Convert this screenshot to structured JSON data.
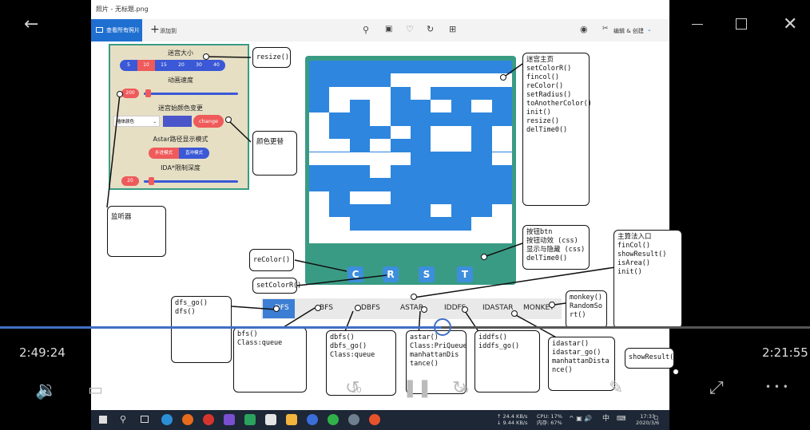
{
  "player": {
    "back_icon": "back-arrow-icon",
    "minimize_icon": "minimize-icon",
    "maximize_icon": "maximize-icon",
    "close_icon": "close-icon",
    "elapsed": "2:49:24",
    "remaining": "2:21:55",
    "progress_fraction": 0.545,
    "volume_icon": "volume-icon",
    "subtitle_icon": "subtitles-icon",
    "skip_back_label": "10",
    "skip_forward_label": "30",
    "more_label": "• • •"
  },
  "photos": {
    "window_title": "照片 - 无标题.png",
    "see_all_label": "查看所有照片",
    "add_to_label": "添加到",
    "edit_create_label": "编辑 & 创建"
  },
  "panel": {
    "maze_size_label": "迷宫大小",
    "sizes": [
      "5",
      "10",
      "15",
      "20",
      "30",
      "40"
    ],
    "selected_size": "10",
    "anim_speed_label": "动画速度",
    "anim_speed_value": "200",
    "color_change_label": "迷宫始颜色变更",
    "color_select": "墙体颜色",
    "change_label": "change",
    "astar_mode_label": "Astar路径显示模式",
    "astar_modes": [
      "步进模式",
      "直冲模式"
    ],
    "ida_depth_label": "IDA*限制深度",
    "ida_depth_value": "20"
  },
  "notes": {
    "resize": "resize()",
    "color_change": "颜色更替",
    "listener": "监听器",
    "maze_home": "迷宫主页\nsetColorR()\nfincol()\nreColor()\nsetRadius()\ntoAnotherColor()\n init()\n resize()\n delTime0()",
    "buttons": "按钮btn\n按钮动效 (css)\n显示与隐藏 (css)\ndelTime0()",
    "main_entry": "主算法入口\nfinCol()\nshowResult()\nisArea()\ninit()",
    "recolor": "reColor()",
    "setcolor": "setColorR()",
    "dfs_go": "dfs_go()\ndfs()",
    "bfs": "bfs()\nClass:queue",
    "dbfs": "dbfs()\ndbfs_go()\nClass:queue",
    "astar": "astar()\nClass:PriQueue\nmanhattanDis\ntance()",
    "iddfs": "iddfs()\niddfs_go()",
    "idastar": "idastar()\nidastar_go()\nmanhattanDista\nnce()",
    "monkey": "monkey()\nRandomSo\nrt()",
    "show_result": "showResult()"
  },
  "maze_buttons": [
    "C",
    "R",
    "S",
    "T"
  ],
  "algorithms": [
    "DFS",
    "BFS",
    "DBFS",
    "ASTAR",
    "IDDFS",
    "IDASTAR",
    "MONKEY"
  ],
  "taskbar": {
    "net_up": "↑ 24.4 KB/s",
    "net_down": "↓ 9.44 KB/s",
    "cpu": "CPU: 17%",
    "mem": "内存: 67%",
    "ime": "中",
    "clock_time": "17:33",
    "clock_date": "2020/3/6"
  },
  "colors": {
    "maze_blue": "#2e86de",
    "panel_bg": "#e6dfc4",
    "accent_red": "#ef5a5a",
    "accent_blue": "#3b58d6",
    "teal": "#3a9b84"
  }
}
